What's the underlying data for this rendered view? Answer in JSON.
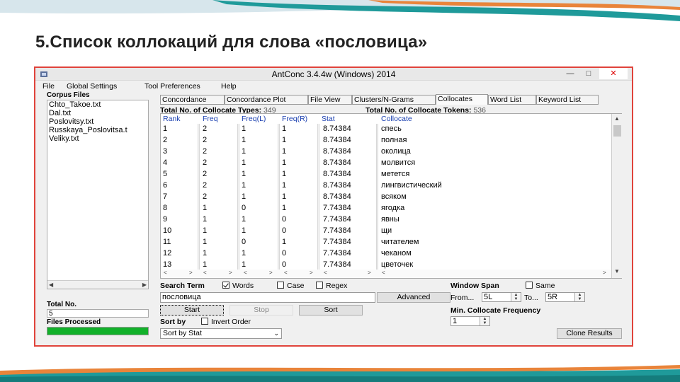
{
  "slide": {
    "title": "5.Список коллокаций для слова «пословица»",
    "colors": {
      "teal": "#1f9a9a",
      "orange": "#e9843a",
      "window_border": "#e0433b",
      "progress": "#12b12a"
    }
  },
  "window": {
    "title": "AntConc 3.4.4w (Windows) 2014",
    "buttons": {
      "minimize": "—",
      "maximize": "□",
      "close": "✕"
    },
    "icon": "antconc-app-icon"
  },
  "menu": [
    "File",
    "Global Settings",
    "Tool Preferences",
    "Help"
  ],
  "left": {
    "corpus_label": "Corpus Files",
    "files": [
      "Chto_Takoe.txt",
      "Dal.txt",
      "Poslovitsy.txt",
      "Russkaya_Poslovitsa.t",
      "Veliky.txt"
    ],
    "total_label": "Total No.",
    "total_value": "5",
    "processed_label": "Files Processed",
    "progress": 1.0
  },
  "tabs": [
    "Concordance",
    "Concordance Plot",
    "File View",
    "Clusters/N-Grams",
    "Collocates",
    "Word List",
    "Keyword List"
  ],
  "active_tab": "Collocates",
  "stats": {
    "types_label": "Total No. of Collocate Types:",
    "types_value": "349",
    "tokens_label": "Total No. of Collocate Tokens:",
    "tokens_value": "536"
  },
  "table": {
    "headers": [
      "Rank",
      "Freq",
      "Freq(L)",
      "Freq(R)",
      "Stat",
      "Collocate"
    ],
    "rows": [
      [
        "1",
        "2",
        "1",
        "1",
        "8.74384",
        "спесь"
      ],
      [
        "2",
        "2",
        "1",
        "1",
        "8.74384",
        "полная"
      ],
      [
        "3",
        "2",
        "1",
        "1",
        "8.74384",
        "околица"
      ],
      [
        "4",
        "2",
        "1",
        "1",
        "8.74384",
        "молвится"
      ],
      [
        "5",
        "2",
        "1",
        "1",
        "8.74384",
        "метется"
      ],
      [
        "6",
        "2",
        "1",
        "1",
        "8.74384",
        "лингвистический"
      ],
      [
        "7",
        "2",
        "1",
        "1",
        "8.74384",
        "всяком"
      ],
      [
        "8",
        "1",
        "0",
        "1",
        "7.74384",
        "ягодка"
      ],
      [
        "9",
        "1",
        "1",
        "0",
        "7.74384",
        "явны"
      ],
      [
        "10",
        "1",
        "1",
        "0",
        "7.74384",
        "щи"
      ],
      [
        "11",
        "1",
        "0",
        "1",
        "7.74384",
        "читателем"
      ],
      [
        "12",
        "1",
        "1",
        "0",
        "7.74384",
        "чеканом"
      ],
      [
        "13",
        "1",
        "1",
        "0",
        "7.74384",
        "цветочек"
      ]
    ]
  },
  "search": {
    "label": "Search Term",
    "words": "Words",
    "words_checked": true,
    "case": "Case",
    "regex": "Regex",
    "value": "пословица",
    "advanced": "Advanced",
    "start": "Start",
    "stop": "Stop",
    "sort": "Sort"
  },
  "window_span": {
    "label": "Window Span",
    "same": "Same",
    "from_label": "From",
    "from_value": "5L",
    "to_label": "To",
    "to_value": "5R"
  },
  "min_freq": {
    "label": "Min. Collocate Frequency",
    "value": "1"
  },
  "sortby": {
    "label": "Sort by",
    "invert": "Invert Order",
    "selected": "Sort by Stat"
  },
  "clone": "Clone Results"
}
